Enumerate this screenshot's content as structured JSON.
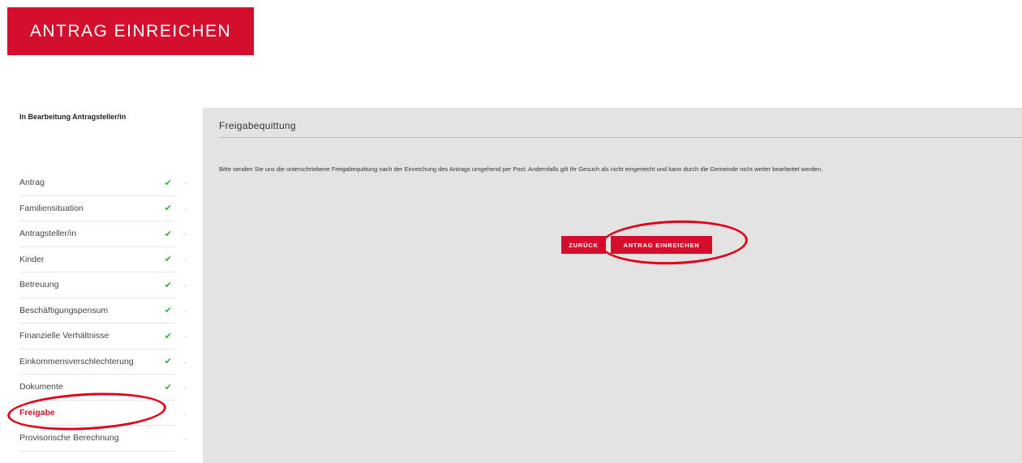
{
  "banner": {
    "label": "ANTRAG EINREICHEN"
  },
  "sidebar": {
    "status": "In Bearbeitung Antragsteller/in",
    "items": [
      {
        "label": "Antrag",
        "icon": "check-icon",
        "check": "✔"
      },
      {
        "label": "Familiensituation",
        "icon": "check-icon",
        "check": "✔"
      },
      {
        "label": "Antragsteller/in",
        "icon": "check-icon",
        "check": "✔"
      },
      {
        "label": "Kinder",
        "icon": "check-icon",
        "check": "✔"
      },
      {
        "label": "Betreuung",
        "icon": "check-icon",
        "check": "✔"
      },
      {
        "label": "Beschäftigungspensum",
        "icon": "check-icon",
        "check": "✔"
      },
      {
        "label": "Finanzielle Verhältnisse",
        "icon": "check-icon",
        "check": "✔"
      },
      {
        "label": "Einkommensverschlechterung",
        "icon": "check-icon",
        "check": "✔"
      },
      {
        "label": "Dokumente",
        "icon": "check-icon",
        "check": "✔"
      },
      {
        "label": "Freigabe",
        "active": true
      },
      {
        "label": "Provisorische Berechnung"
      }
    ]
  },
  "main": {
    "title": "Freigabequittung",
    "text": "Bitte senden Sie uns die unterschriebene Freigabequittung nach der Einreichung des Antrags umgehend per Post. Andernfalls gilt Ihr Gesuch als nicht eingereicht und kann durch die Gemeinde nicht weiter bearbeitet werden.",
    "back_label": "ZURÜCK",
    "submit_label": "ANTRAG EINREICHEN"
  },
  "colors": {
    "accent": "#d40f2e",
    "check": "#3daa3d",
    "panel": "#e3e3e3",
    "highlight": "#e0001b"
  }
}
